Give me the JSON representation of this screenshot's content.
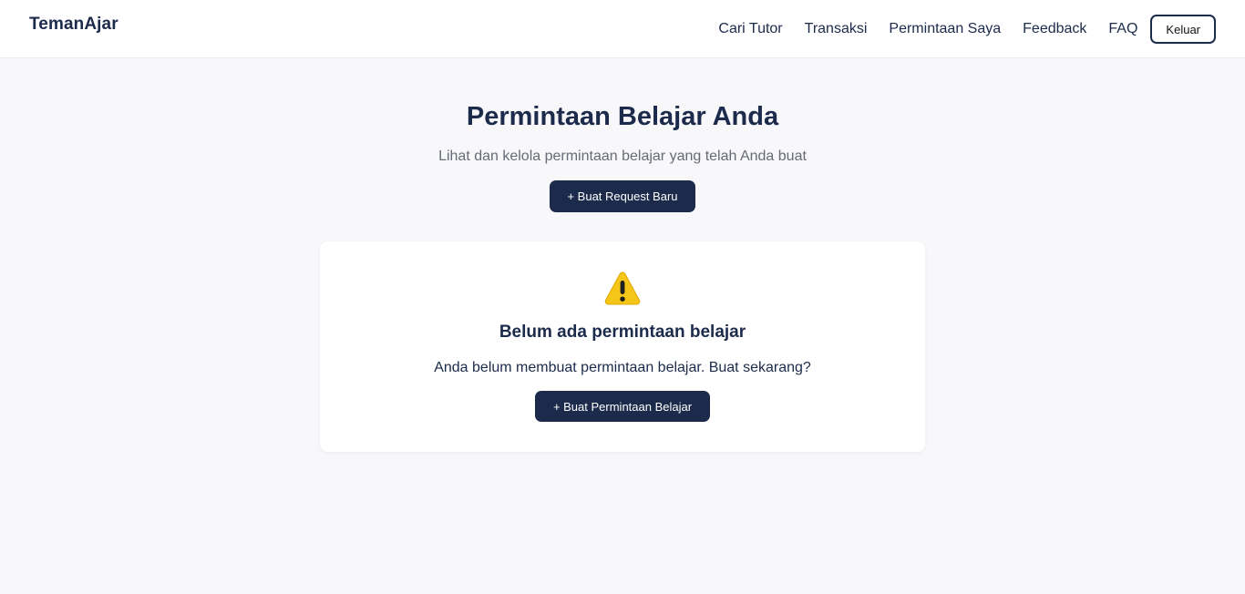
{
  "navbar": {
    "brand": "TemanAjar",
    "links": [
      "Cari Tutor",
      "Transaksi",
      "Permintaan Saya",
      "Feedback",
      "FAQ"
    ],
    "logout_label": "Keluar"
  },
  "header": {
    "title": "Permintaan Belajar Anda",
    "subtitle": "Lihat dan kelola permintaan belajar yang telah Anda buat",
    "new_request_label": "+ Buat Request Baru"
  },
  "empty_state": {
    "icon": "warning-icon",
    "title": "Belum ada permintaan belajar",
    "message": "Anda belum membuat permintaan belajar. Buat sekarang?",
    "cta_label": "+ Buat Permintaan Belajar"
  },
  "colors": {
    "primary": "#1c2b4b",
    "background": "#f8f8fa",
    "card": "#ffffff",
    "muted_text": "#666b75",
    "warning": "#f5c518"
  }
}
